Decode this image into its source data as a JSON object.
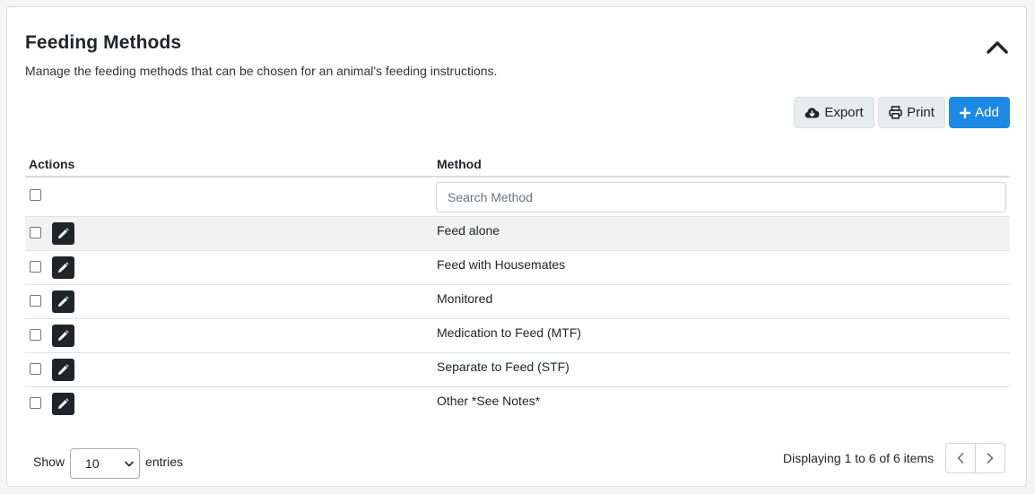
{
  "header": {
    "title": "Feeding Methods",
    "subtitle": "Manage the feeding methods that can be chosen for an animal's feeding instructions.",
    "collapse_icon": "chevron-up-icon"
  },
  "toolbar": {
    "export_label": "Export",
    "export_icon": "cloud-download-icon",
    "print_label": "Print",
    "print_icon": "printer-icon",
    "add_label": "Add",
    "add_icon": "plus-icon",
    "add_color": "#1e88e5"
  },
  "table": {
    "columns": [
      "Actions",
      "Method"
    ],
    "search_placeholder": "Search Method",
    "rows": [
      {
        "method": "Feed alone"
      },
      {
        "method": "Feed with Housemates"
      },
      {
        "method": "Monitored"
      },
      {
        "method": "Medication to Feed (MTF)"
      },
      {
        "method": "Separate to Feed (STF)"
      },
      {
        "method": "Other *See Notes*"
      }
    ],
    "edit_icon": "pencil-icon"
  },
  "footer": {
    "show_label": "Show",
    "page_size": "10",
    "entries_label": "entries",
    "info": "Displaying 1 to 6 of 6 items",
    "prev_icon": "chevron-left-icon",
    "next_icon": "chevron-right-icon"
  }
}
